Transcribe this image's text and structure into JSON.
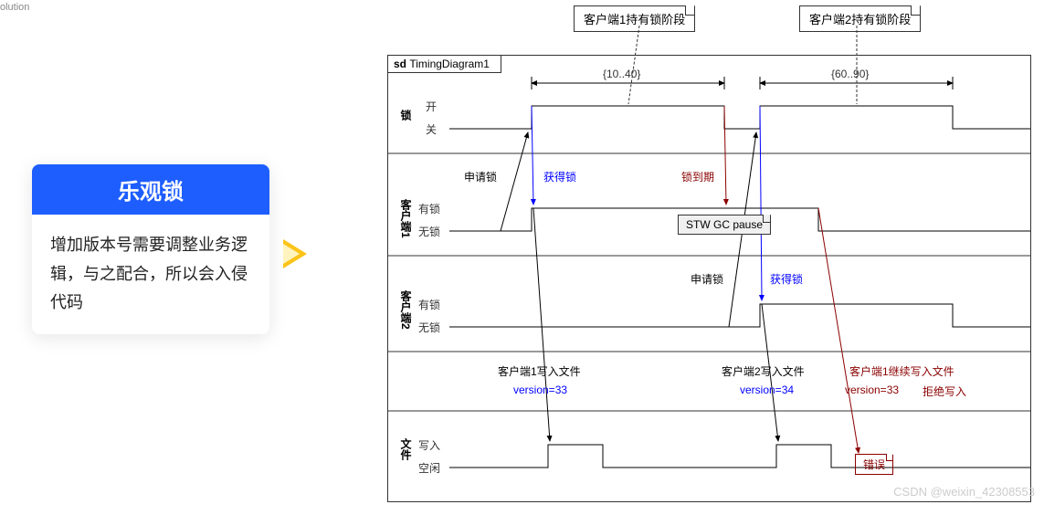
{
  "tab": "olution",
  "card": {
    "title": "乐观锁",
    "body": "增加版本号需要调整业务逻辑，与之配合，所以会入侵代码"
  },
  "notes": {
    "n1": "客户端1持有锁阶段",
    "n2": "客户端2持有锁阶段"
  },
  "frame": {
    "name": "sd",
    "title": "TimingDiagram1"
  },
  "lanes": {
    "lock": {
      "name": "锁",
      "hi": "开",
      "lo": "关"
    },
    "c1": {
      "name": "客户端1",
      "hi": "有锁",
      "lo": "无锁"
    },
    "c2": {
      "name": "客户端2",
      "hi": "有锁",
      "lo": "无锁"
    },
    "file": {
      "name": "文件",
      "hi": "写入",
      "lo": "空闲"
    }
  },
  "times": {
    "t1": "{10..40}",
    "t2": "{60..90}"
  },
  "ann": {
    "apply1": "申请锁",
    "get1": "获得锁",
    "expire": "锁到期",
    "apply2": "申请锁",
    "get2": "获得锁",
    "w1": "客户端1写入文件",
    "w2": "客户端2写入文件",
    "w3": "客户端1继续写入文件",
    "v1": "version=33",
    "v2": "version=34",
    "v3": "version=33",
    "reject": "拒绝写入",
    "stw": "STW GC pause",
    "err": "错误"
  },
  "watermark": "CSDN @weixin_42308553",
  "chart_data": {
    "type": "timing_diagram",
    "title": "TimingDiagram1",
    "constraints": [
      {
        "label": "{10..40}",
        "from": 10,
        "to": 40
      },
      {
        "label": "{60..90}",
        "from": 60,
        "to": 90
      }
    ],
    "lanes": [
      {
        "name": "锁",
        "states": [
          "关",
          "开"
        ],
        "transitions": [
          {
            "t": 10,
            "to": "开"
          },
          {
            "t": 40,
            "to": "关"
          },
          {
            "t": 60,
            "to": "开"
          },
          {
            "t": 90,
            "to": "关"
          }
        ]
      },
      {
        "name": "客户端1",
        "states": [
          "无锁",
          "有锁"
        ],
        "note": "STW GC pause",
        "transitions": [
          {
            "t": 10,
            "to": "有锁",
            "label": "获得锁",
            "color": "blue"
          },
          {
            "t": 40,
            "label": "锁到期",
            "color": "darkred"
          },
          {
            "t": 70,
            "to": "无锁"
          }
        ]
      },
      {
        "name": "客户端2",
        "states": [
          "无锁",
          "有锁"
        ],
        "transitions": [
          {
            "t": 45,
            "label": "申请锁"
          },
          {
            "t": 60,
            "to": "有锁",
            "label": "获得锁",
            "color": "blue"
          },
          {
            "t": 90,
            "to": "无锁"
          }
        ]
      },
      {
        "name": "文件",
        "states": [
          "空闲",
          "写入"
        ],
        "events": [
          {
            "t": 12,
            "label": "客户端1写入文件",
            "version": "version=33",
            "color": "blue"
          },
          {
            "t": 62,
            "label": "客户端2写入文件",
            "version": "version=34",
            "color": "blue"
          },
          {
            "t": 72,
            "label": "客户端1继续写入文件",
            "version": "version=33",
            "result": "拒绝写入 错误",
            "color": "darkred"
          }
        ]
      }
    ]
  }
}
